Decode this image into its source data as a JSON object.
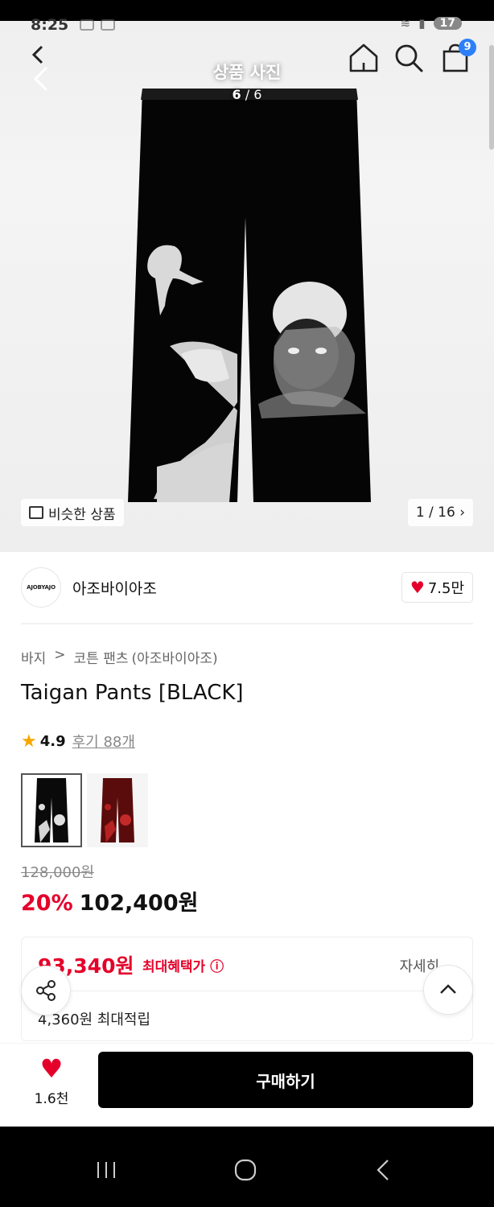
{
  "status": {
    "time": "8:25",
    "battery": "17"
  },
  "header": {
    "title": "상품 사진",
    "current": "6",
    "separator": "/",
    "total": "6",
    "cart_count": "9"
  },
  "gallery": {
    "similar_label": "비슷한 상품",
    "counter": "1 / 16"
  },
  "brand": {
    "logo_text": "AJOBYAJO",
    "name": "아조바이아조",
    "likes": "7.5만"
  },
  "product": {
    "breadcrumb": [
      "바지",
      "코튼 팬츠",
      "(아조바이아조)"
    ],
    "title": "Taigan Pants [BLACK]",
    "rating": "4.9",
    "review_label": "후기 88개",
    "swatches": [
      "black",
      "red"
    ],
    "original_price": "128,000원",
    "discount": "20%",
    "price": "102,400원"
  },
  "benefit": {
    "max_price": "93,340원",
    "label": "최대혜택가",
    "detail": "자세히",
    "points": "4,360원 최대적립"
  },
  "bottom": {
    "wish_count": "1.6천",
    "buy_label": "구매하기"
  },
  "colors": {
    "accent_red": "#e5002a",
    "badge_blue": "#2d7ff9",
    "star": "#f7a600"
  }
}
